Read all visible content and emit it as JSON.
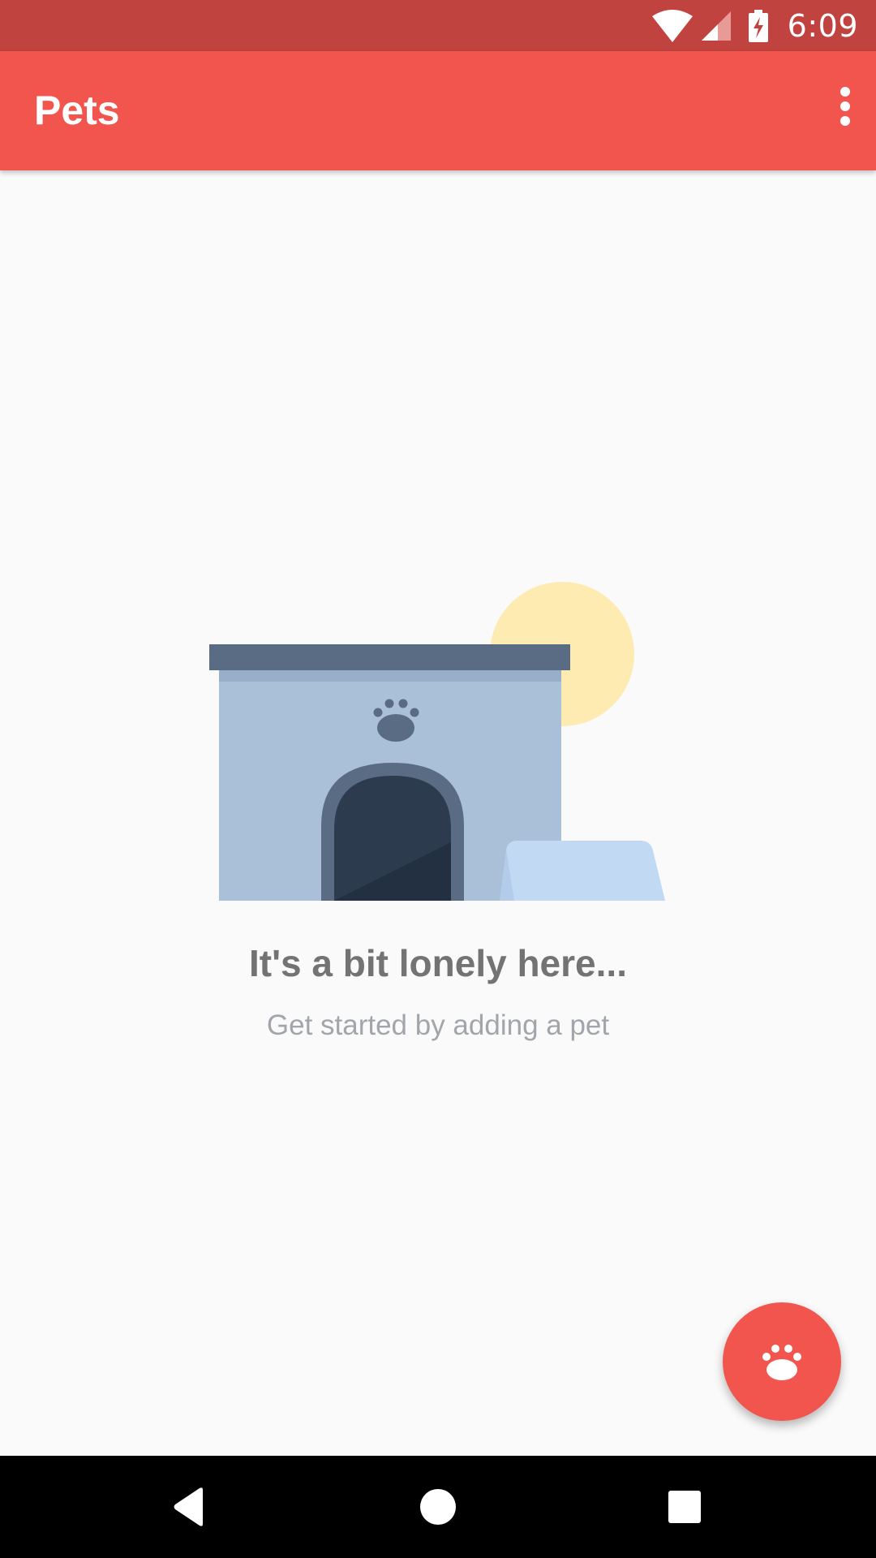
{
  "status_bar": {
    "time": "6:09",
    "icons": [
      "wifi-icon",
      "cell-signal-icon",
      "battery-charging-icon"
    ],
    "color": "#c0433f"
  },
  "app_bar": {
    "title": "Pets",
    "menu_icon": "more-vert-icon",
    "color": "#f2544e"
  },
  "empty_state": {
    "illustration": "pet-house-illustration",
    "title": "It's a bit lonely here...",
    "subtitle": "Get started by adding a pet"
  },
  "fab": {
    "icon": "paw-icon",
    "color": "#f2544e"
  },
  "nav_bar": {
    "buttons": [
      "back-icon",
      "home-icon",
      "recents-icon"
    ]
  }
}
